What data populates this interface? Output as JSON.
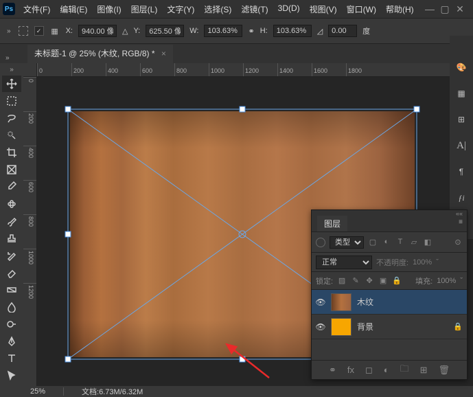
{
  "menu": [
    "文件(F)",
    "编辑(E)",
    "图像(I)",
    "图层(L)",
    "文字(Y)",
    "选择(S)",
    "滤镜(T)",
    "3D(D)",
    "视图(V)",
    "窗口(W)",
    "帮助(H)"
  ],
  "options": {
    "x_label": "X:",
    "x": "940.00 像",
    "y_label": "Y:",
    "y": "625.50 像",
    "w_label": "W:",
    "w": "103.63%",
    "h_label": "H:",
    "h": "103.63%",
    "angle": "0.00",
    "angle_unit": "度"
  },
  "tab": "未标题-1 @ 25% (木纹, RGB/8) *",
  "ruler_h": [
    "0",
    "200",
    "400",
    "600",
    "800",
    "1000",
    "1200",
    "1400",
    "1600",
    "1800"
  ],
  "ruler_v": [
    "0",
    "200",
    "400",
    "600",
    "800",
    "1000",
    "1200"
  ],
  "status": {
    "zoom": "25%",
    "doc": "文档:6.73M/6.32M"
  },
  "layers": {
    "title": "图层",
    "filter_type": "类型",
    "blend": "正常",
    "opacity_label": "不透明度:",
    "opacity": "100%",
    "lock_label": "锁定:",
    "fill_label": "填充:",
    "fill": "100%",
    "items": [
      {
        "name": "木纹",
        "locked": false
      },
      {
        "name": "背景",
        "locked": true
      }
    ]
  }
}
